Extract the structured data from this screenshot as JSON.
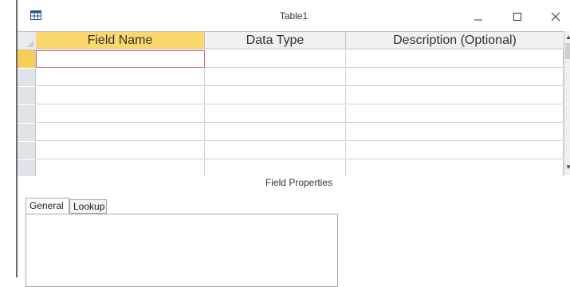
{
  "window": {
    "title": "Table1",
    "icon": "table-grid-icon",
    "controls": [
      "minimize-icon",
      "maximize-icon",
      "close-icon"
    ]
  },
  "grid": {
    "columns": [
      {
        "label": "Field Name"
      },
      {
        "label": "Data Type"
      },
      {
        "label": "Description (Optional)"
      }
    ],
    "rows": [
      {
        "field_name": "",
        "data_type": "",
        "description": ""
      },
      {
        "field_name": "",
        "data_type": "",
        "description": ""
      },
      {
        "field_name": "",
        "data_type": "",
        "description": ""
      },
      {
        "field_name": "",
        "data_type": "",
        "description": ""
      },
      {
        "field_name": "",
        "data_type": "",
        "description": ""
      },
      {
        "field_name": "",
        "data_type": "",
        "description": ""
      },
      {
        "field_name": "",
        "data_type": "",
        "description": ""
      }
    ],
    "active_row": 1,
    "active_column": "Field Name"
  },
  "field_properties": {
    "label": "Field Properties",
    "tabs": [
      {
        "label": "General",
        "selected": true
      },
      {
        "label": "Lookup",
        "selected": false
      }
    ]
  },
  "colors": {
    "active_header": "#f9d86d",
    "active_selector": "#f7cf58",
    "focus_border": "#d66b6b"
  }
}
